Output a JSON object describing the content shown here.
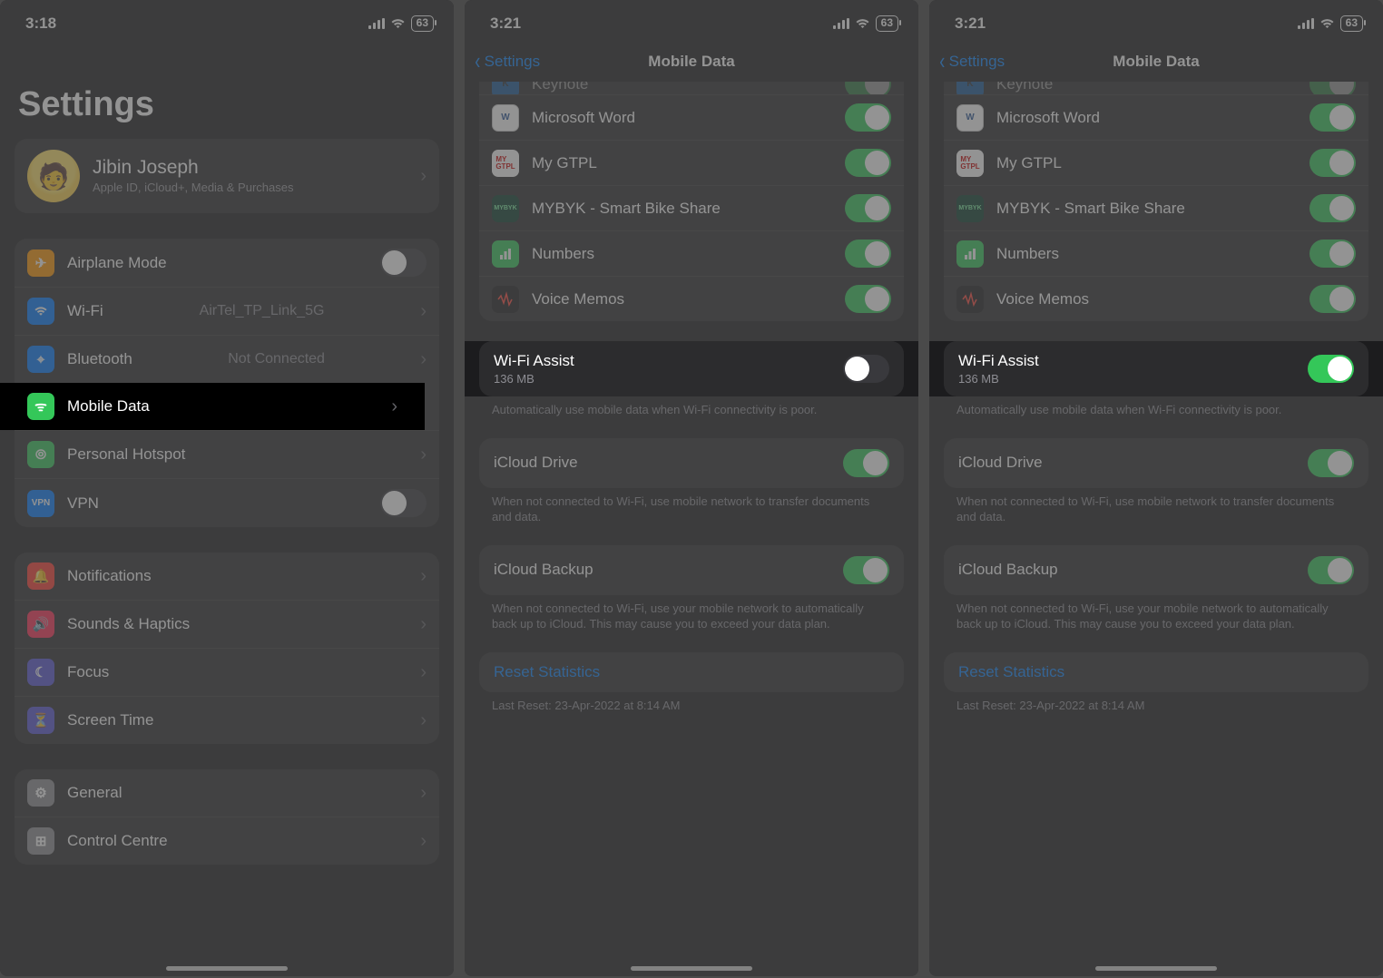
{
  "screen1": {
    "time": "3:18",
    "battery": "63",
    "title": "Settings",
    "profile": {
      "name": "Jibin Joseph",
      "sub": "Apple ID, iCloud+, Media & Purchases"
    },
    "group1": {
      "airplane": "Airplane Mode",
      "wifi": "Wi-Fi",
      "wifi_detail": "AirTel_TP_Link_5G",
      "bt": "Bluetooth",
      "bt_detail": "Not Connected",
      "mobile": "Mobile Data",
      "hotspot": "Personal Hotspot",
      "vpn": "VPN"
    },
    "group2": {
      "notif": "Notifications",
      "sound": "Sounds & Haptics",
      "focus": "Focus",
      "screen": "Screen Time"
    },
    "group3": {
      "general": "General",
      "cc": "Control Centre"
    }
  },
  "screen2": {
    "time": "3:21",
    "battery": "63",
    "back": "Settings",
    "title": "Mobile Data",
    "apps": {
      "keynote": "Keynote",
      "word": "Microsoft Word",
      "gtpl": "My GTPL",
      "mybyk": "MYBYK - Smart Bike Share",
      "numbers": "Numbers",
      "voice": "Voice Memos"
    },
    "wifi_assist": {
      "title": "Wi-Fi Assist",
      "sub": "136 MB",
      "on": false
    },
    "wifi_assist_foot": "Automatically use mobile data when Wi-Fi connectivity is poor.",
    "icloud_drive": "iCloud Drive",
    "icloud_drive_foot": "When not connected to Wi-Fi, use mobile network to transfer documents and data.",
    "icloud_backup": "iCloud Backup",
    "icloud_backup_foot": "When not connected to Wi-Fi, use your mobile network to automatically back up to iCloud. This may cause you to exceed your data plan.",
    "reset": "Reset Statistics",
    "last_reset": "Last Reset: 23-Apr-2022 at 8:14 AM"
  },
  "screen3": {
    "time": "3:21",
    "battery": "63",
    "back": "Settings",
    "title": "Mobile Data",
    "wifi_assist": {
      "title": "Wi-Fi Assist",
      "sub": "136 MB",
      "on": true
    }
  }
}
